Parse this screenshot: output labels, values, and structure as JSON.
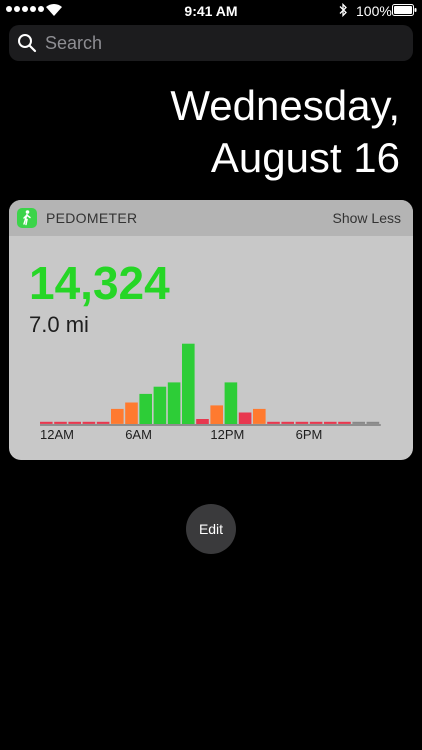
{
  "status_bar": {
    "time": "9:41 AM",
    "battery": "100%"
  },
  "search": {
    "placeholder": "Search"
  },
  "date": {
    "line1": "Wednesday,",
    "line2": "August 16"
  },
  "widget": {
    "title": "PEDOMETER",
    "toggle_label": "Show Less",
    "steps": "14,324",
    "distance": "7.0 mi",
    "icon": "walking-figure-icon",
    "icon_color": "#3cd44a"
  },
  "chart_data": {
    "type": "bar",
    "categories": [
      "0",
      "1",
      "2",
      "3",
      "4",
      "5",
      "6",
      "7",
      "8",
      "9",
      "10",
      "11",
      "12",
      "13",
      "14",
      "15",
      "16",
      "17",
      "18",
      "19",
      "20",
      "21",
      "22",
      "23"
    ],
    "values": [
      150,
      150,
      150,
      150,
      150,
      1050,
      1500,
      2100,
      2600,
      2900,
      5600,
      350,
      1300,
      2900,
      800,
      1050,
      150,
      150,
      150,
      150,
      150,
      150,
      150,
      150
    ],
    "colors": [
      "#e8384f",
      "#e8384f",
      "#e8384f",
      "#e8384f",
      "#e8384f",
      "#ff7a2f",
      "#ff7a2f",
      "#2dcd37",
      "#2dcd37",
      "#2dcd37",
      "#2dcd37",
      "#e8384f",
      "#ff7a2f",
      "#2dcd37",
      "#e8384f",
      "#ff7a2f",
      "#e8384f",
      "#e8384f",
      "#e8384f",
      "#e8384f",
      "#e8384f",
      "#e8384f",
      "#888888",
      "#888888"
    ],
    "ylim": [
      0,
      6000
    ],
    "x_tick_labels": [
      {
        "index": 0,
        "label": "12AM"
      },
      {
        "index": 6,
        "label": "6AM"
      },
      {
        "index": 12,
        "label": "12PM"
      },
      {
        "index": 18,
        "label": "6PM"
      }
    ],
    "grid": false
  },
  "edit": {
    "label": "Edit"
  }
}
